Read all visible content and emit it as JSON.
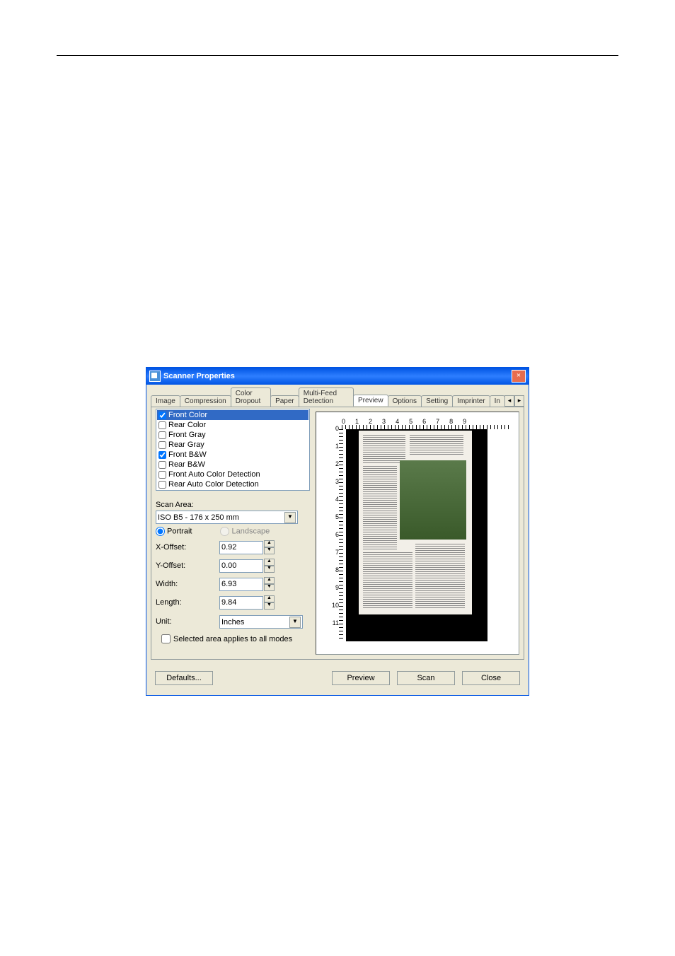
{
  "window": {
    "title": "Scanner Properties"
  },
  "tabs": {
    "image": "Image",
    "compression": "Compression",
    "color_dropout": "Color Dropout",
    "paper": "Paper",
    "multifeed": "Multi-Feed Detection",
    "preview": "Preview",
    "options": "Options",
    "setting": "Setting",
    "imprinter": "Imprinter",
    "overflow": "In"
  },
  "side_list": {
    "front_color": "Front Color",
    "rear_color": "Rear Color",
    "front_gray": "Front Gray",
    "rear_gray": "Rear Gray",
    "front_bw": "Front B&W",
    "rear_bw": "Rear B&W",
    "front_auto": "Front Auto Color Detection",
    "rear_auto": "Rear Auto Color Detection"
  },
  "scan_area": {
    "label": "Scan Area:",
    "value": "ISO B5 - 176 x 250 mm",
    "portrait": "Portrait",
    "landscape": "Landscape"
  },
  "fields": {
    "xoffset_label": "X-Offset:",
    "xoffset_value": "0.92",
    "yoffset_label": "Y-Offset:",
    "yoffset_value": "0.00",
    "width_label": "Width:",
    "width_value": "6.93",
    "length_label": "Length:",
    "length_value": "9.84",
    "unit_label": "Unit:",
    "unit_value": "Inches"
  },
  "apply_all": "Selected area applies to all modes",
  "ruler_h": [
    "0",
    "1",
    "2",
    "3",
    "4",
    "5",
    "6",
    "7",
    "8",
    "9"
  ],
  "ruler_v": [
    "0",
    "1",
    "2",
    "3",
    "4",
    "5",
    "6",
    "7",
    "8",
    "9",
    "10",
    "11"
  ],
  "buttons": {
    "defaults": "Defaults...",
    "preview": "Preview",
    "scan": "Scan",
    "close": "Close"
  }
}
